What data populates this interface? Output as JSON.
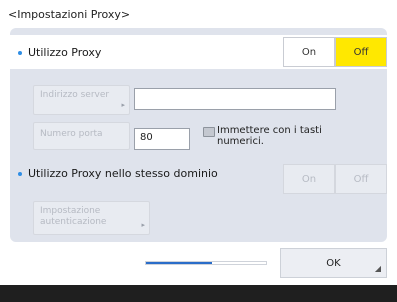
{
  "header": {
    "title": "<Impostazioni Proxy>"
  },
  "use_proxy": {
    "label": "Utilizzo Proxy",
    "on_label": "On",
    "off_label": "Off"
  },
  "server_address": {
    "label": "Indirizzo server",
    "value": ""
  },
  "port_number": {
    "label": "Numero porta",
    "value": "80",
    "hint": "Immettere con i tasti numerici."
  },
  "same_domain": {
    "label": "Utilizzo Proxy nello stesso dominio",
    "on_label": "On",
    "off_label": "Off"
  },
  "auth_settings": {
    "label": "Impostazione autenticazione"
  },
  "progress": {
    "value": 0.55
  },
  "ok_button": {
    "label": "OK"
  },
  "colors": {
    "selected": "#ffe800",
    "bullet": "#2f8ee5",
    "progress": "#2a6dc9"
  },
  "icons": {
    "more": "arrow-icon",
    "hint": "keypad-icon"
  }
}
